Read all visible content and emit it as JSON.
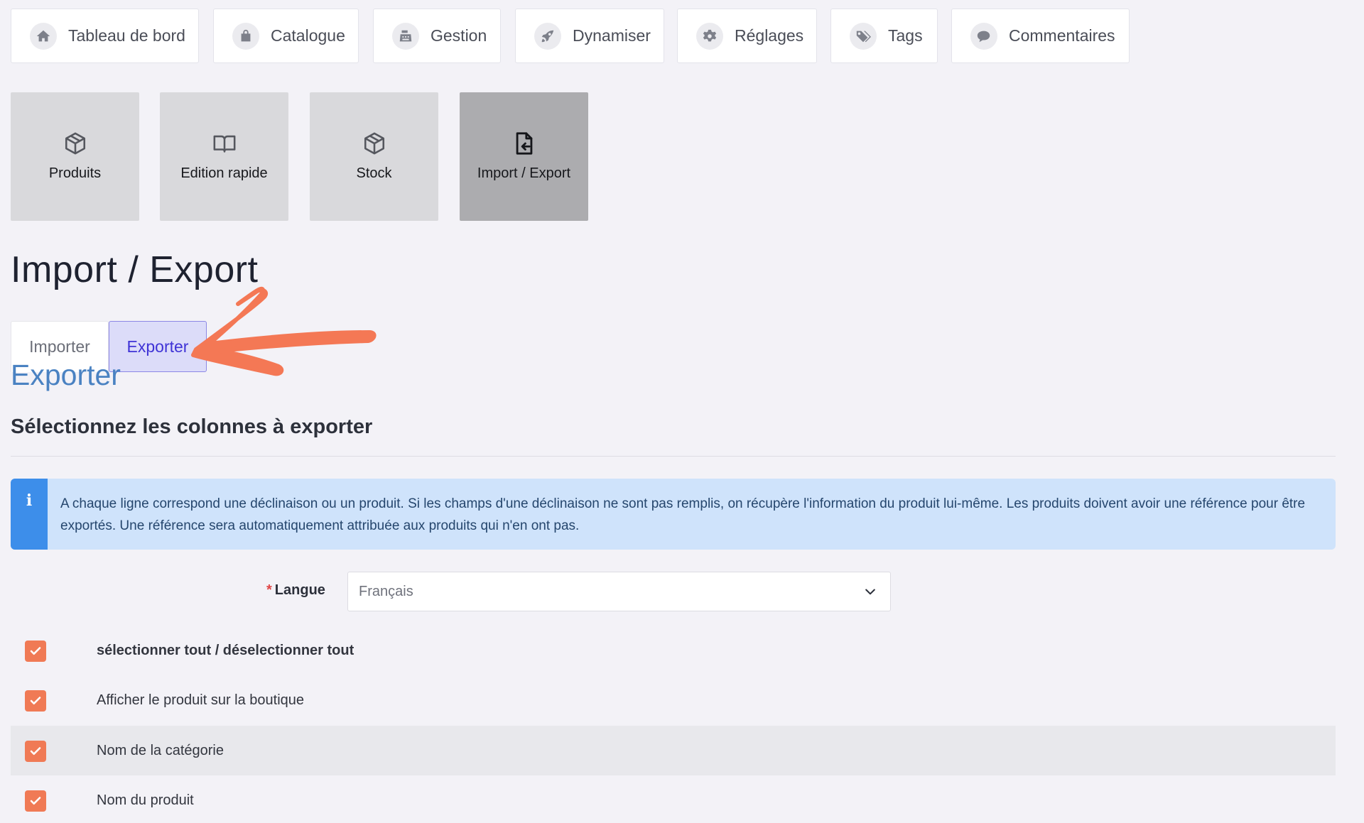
{
  "nav": {
    "items": [
      {
        "label": "Tableau de bord",
        "icon": "home-icon"
      },
      {
        "label": "Catalogue",
        "icon": "shopping-bag-icon"
      },
      {
        "label": "Gestion",
        "icon": "cash-register-icon"
      },
      {
        "label": "Dynamiser",
        "icon": "rocket-icon"
      },
      {
        "label": "Réglages",
        "icon": "gear-icon"
      },
      {
        "label": "Tags",
        "icon": "tags-icon"
      },
      {
        "label": "Commentaires",
        "icon": "comment-icon"
      }
    ]
  },
  "subnav": {
    "items": [
      {
        "label": "Produits",
        "icon": "box-icon"
      },
      {
        "label": "Edition rapide",
        "icon": "book-open-icon"
      },
      {
        "label": "Stock",
        "icon": "box-icon"
      },
      {
        "label": "Import / Export",
        "icon": "file-import-icon",
        "active": true
      }
    ]
  },
  "page": {
    "title": "Import / Export"
  },
  "tabs": {
    "import_label": "Importer",
    "export_label": "Exporter",
    "active": "Exporter"
  },
  "export": {
    "section_title": "Exporter",
    "subheading": "Sélectionnez les colonnes à exporter",
    "info_icon": "i",
    "info_text": "A chaque ligne correspond une déclinaison ou un produit. Si les champs d'une déclinaison ne sont pas remplis, on récupère l'information du produit lui-même. Les produits doivent avoir une référence pour être exportés. Une référence sera automatiquement attribuée aux produits qui n'en ont pas.",
    "language": {
      "required_mark": "*",
      "label": "Langue",
      "value": "Français"
    },
    "columns": [
      {
        "label": "sélectionner tout / déselectionner tout",
        "checked": true
      },
      {
        "label": "Afficher le produit sur la boutique",
        "checked": true
      },
      {
        "label": "Nom de la catégorie",
        "checked": true
      },
      {
        "label": "Nom du produit",
        "checked": true
      }
    ]
  },
  "colors": {
    "accent_tab": "#3f33d6",
    "checkbox": "#f07a55",
    "info_bar": "#3d8eea",
    "annotation_arrow": "#f47855"
  }
}
